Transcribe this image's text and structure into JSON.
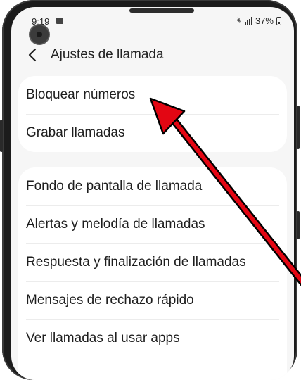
{
  "status_bar": {
    "time": "9:19",
    "battery_percent": "37%",
    "icons": [
      "gallery-icon",
      "mute-icon",
      "signal-icon",
      "battery-icon"
    ]
  },
  "header": {
    "back_icon": "chevron-left-icon",
    "title": "Ajustes de llamada"
  },
  "sections": [
    {
      "items": [
        {
          "label": "Bloquear números"
        },
        {
          "label": "Grabar llamadas"
        }
      ]
    },
    {
      "items": [
        {
          "label": "Fondo de pantalla de llamada"
        },
        {
          "label": "Alertas y melodía de llamadas"
        },
        {
          "label": "Respuesta y finalización de llamadas"
        },
        {
          "label": "Mensajes de rechazo rápido"
        },
        {
          "label": "Ver llamadas al usar apps"
        }
      ]
    }
  ],
  "colors": {
    "screen_background": "#f6f6f6",
    "card_background": "#ffffff",
    "text": "#1e1e1e",
    "arrow": "#e30613",
    "phone_frame": "#1c1c1c"
  }
}
